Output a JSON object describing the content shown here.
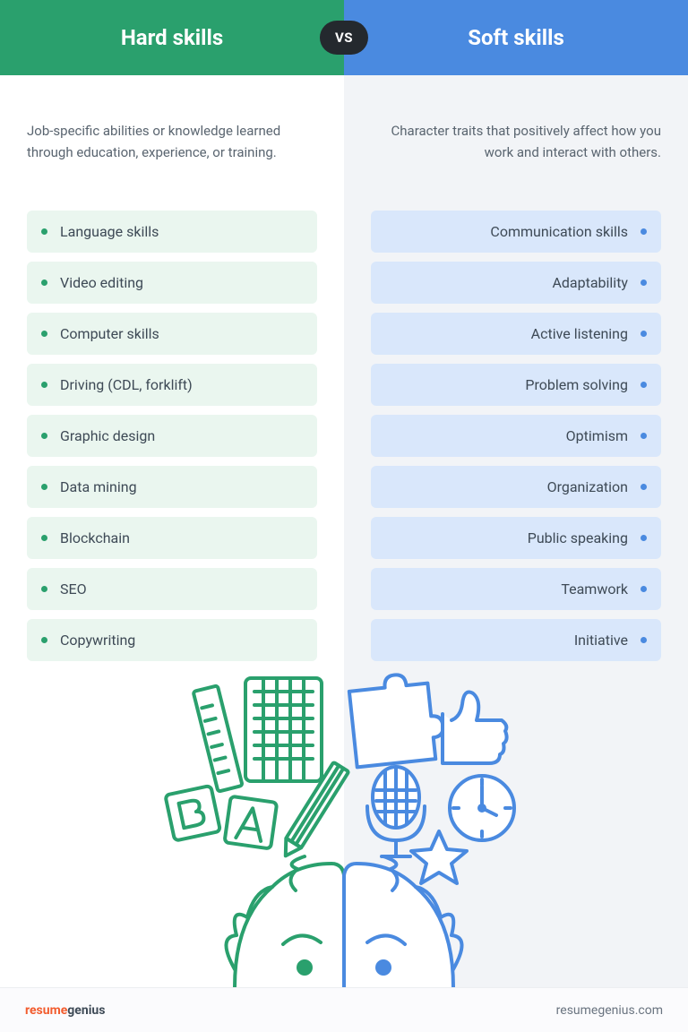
{
  "header": {
    "left_title": "Hard skills",
    "right_title": "Soft skills",
    "vs_label": "VS"
  },
  "hard": {
    "description": "Job-specific abilities or knowledge learned through education, experience, or training.",
    "items": [
      "Language skills",
      "Video editing",
      "Computer skills",
      "Driving (CDL, forklift)",
      "Graphic design",
      "Data mining",
      "Blockchain",
      "SEO",
      "Copywriting"
    ]
  },
  "soft": {
    "description": "Character traits that positively affect how you work and interact with others.",
    "items": [
      "Communication skills",
      "Adaptability",
      "Active listening",
      "Problem solving",
      "Optimism",
      "Organization",
      "Public speaking",
      "Teamwork",
      "Initiative"
    ]
  },
  "footer": {
    "brand_part1": "resume",
    "brand_part2": "genius",
    "site": "resumegenius.com"
  },
  "colors": {
    "hard": "#2aa06d",
    "soft": "#4a8ae0"
  }
}
